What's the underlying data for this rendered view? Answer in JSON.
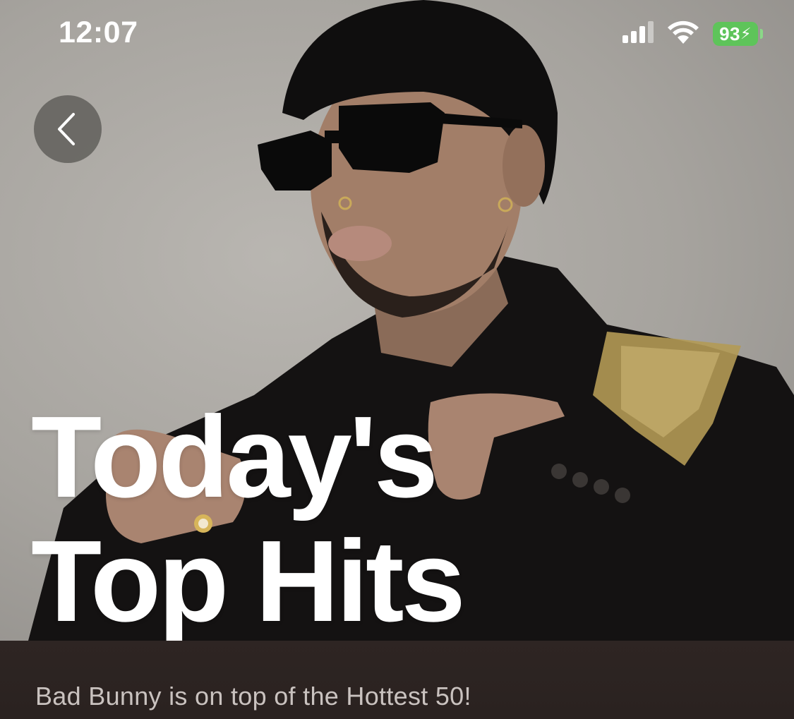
{
  "status_bar": {
    "time": "12:07",
    "battery_level": "93",
    "icons": [
      "cellular-signal-icon",
      "wifi-icon",
      "battery-charging-icon"
    ]
  },
  "header": {
    "back_icon": "chevron-left-icon"
  },
  "playlist": {
    "title_line1": "Today's",
    "title_line2": "Top Hits",
    "description": "Bad Bunny is on top of the Hottest 50!"
  },
  "colors": {
    "background": "#2b2220",
    "battery": "#5ec45a",
    "title": "#ffffff",
    "description": "#c9c2bf"
  }
}
